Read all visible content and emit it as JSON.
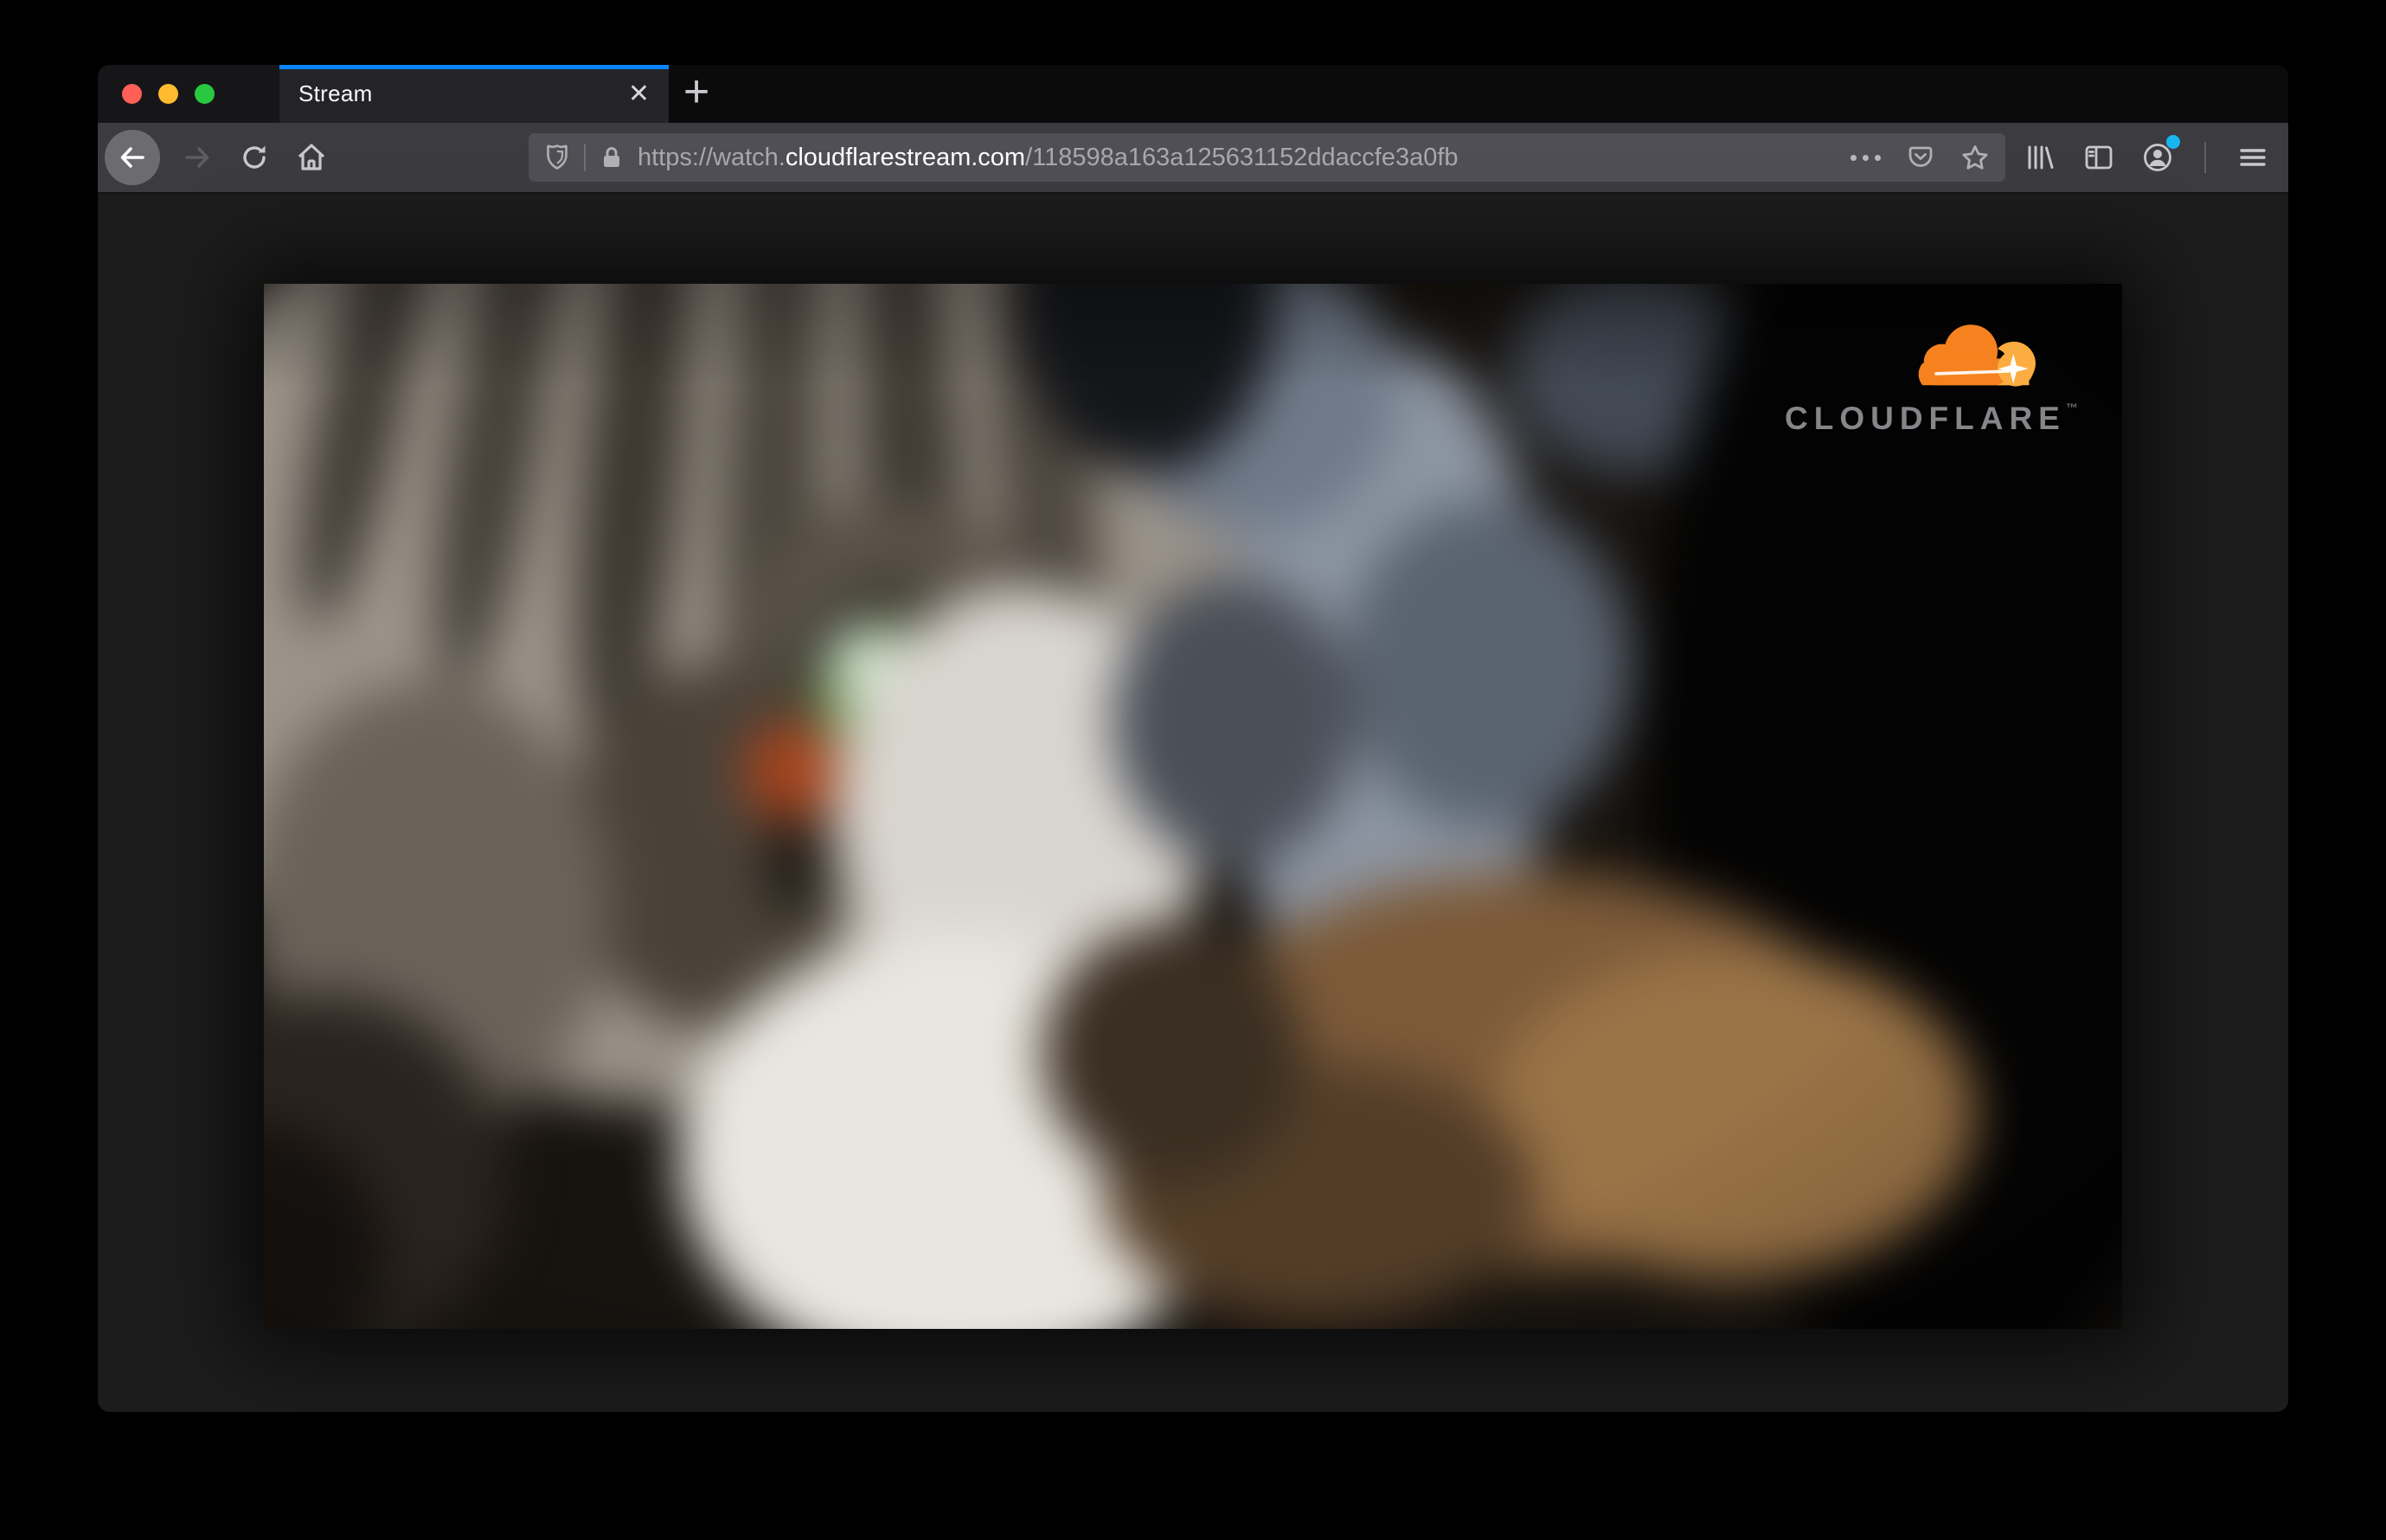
{
  "browser": {
    "tab": {
      "title": "Stream",
      "close_glyph": "✕",
      "new_tab_glyph": "+"
    },
    "urlbar": {
      "scheme": "https://watch.",
      "domain": "cloudflarestream.com",
      "path": "/118598a163a125631152ddaccfe3a0fb"
    },
    "icons": [
      "close-icon",
      "minimize-icon",
      "zoom-icon",
      "back-icon",
      "forward-icon",
      "reload-icon",
      "home-icon",
      "tracking-protection-shield-icon",
      "lock-icon",
      "meatball-menu-icon",
      "pocket-icon",
      "bookmark-star-icon",
      "library-icon",
      "sidebar-icon",
      "account-icon",
      "hamburger-menu-icon",
      "tab-close-icon",
      "new-tab-icon"
    ]
  },
  "video": {
    "brand": {
      "wordmark": "CLOUDFLARE",
      "trademark": "™"
    },
    "description": "blurry close-up of a gray tabby cat with green eyes"
  },
  "colors": {
    "accent_blue": "#0a84ff",
    "traffic_red": "#ff5f57",
    "traffic_yellow": "#febc2e",
    "traffic_green": "#28c840",
    "cloudflare_orange": "#f6821f",
    "cloudflare_orange_light": "#fbad41",
    "account_badge": "#19b5f1"
  }
}
